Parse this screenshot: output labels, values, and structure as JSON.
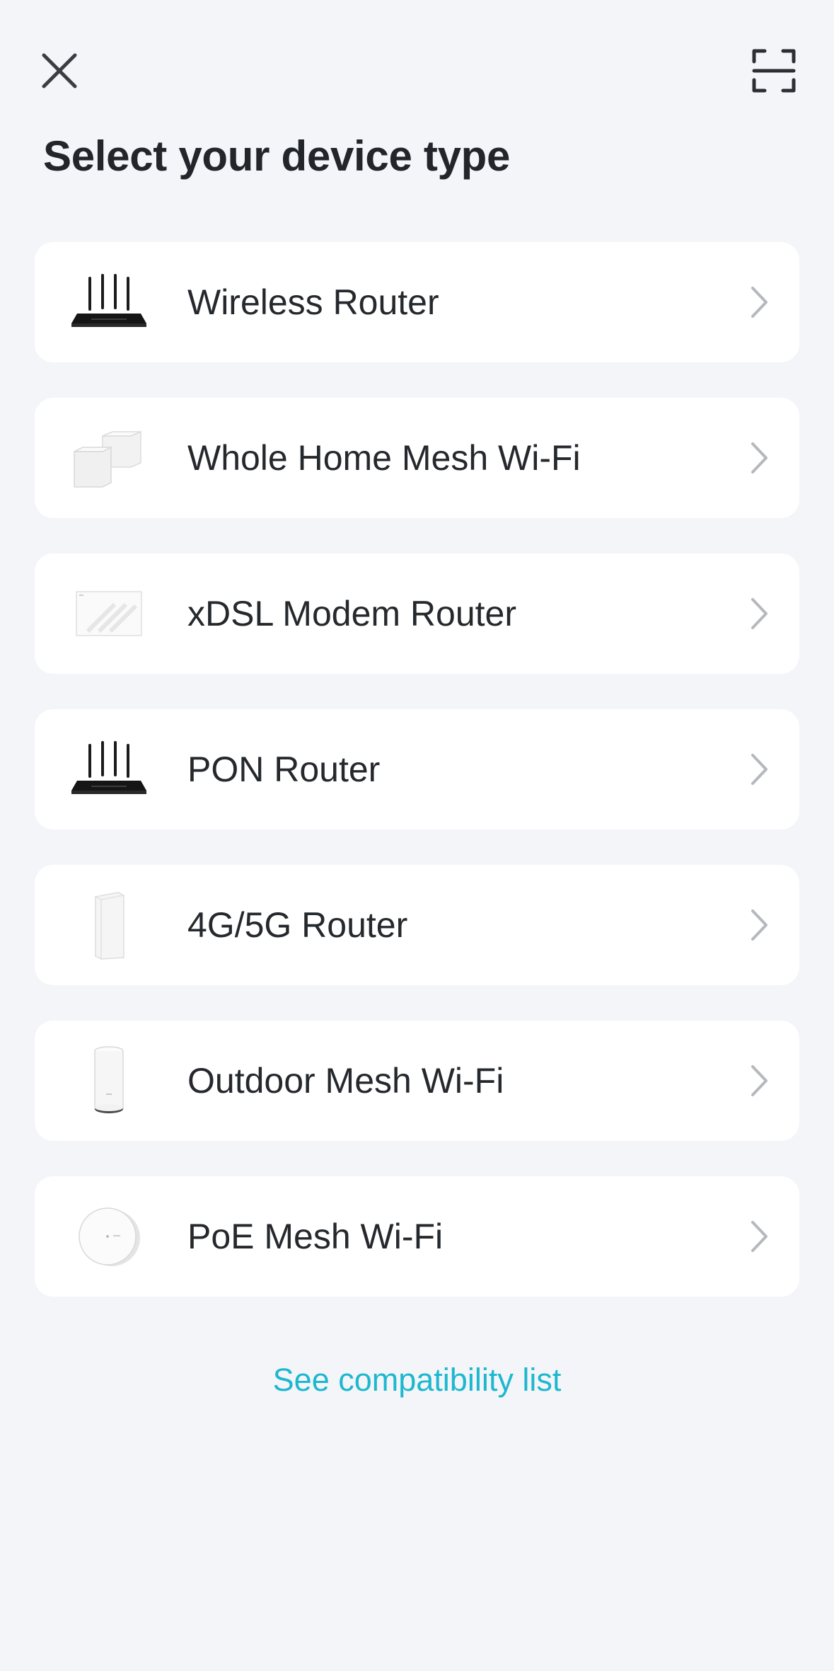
{
  "header": {
    "title": "Select your device type",
    "close_icon": "close-icon",
    "scan_icon": "scan-icon"
  },
  "devices": [
    {
      "label": "Wireless Router",
      "icon": "wireless-router-icon"
    },
    {
      "label": "Whole Home Mesh Wi-Fi",
      "icon": "mesh-wifi-icon"
    },
    {
      "label": "xDSL Modem Router",
      "icon": "modem-router-icon"
    },
    {
      "label": "PON Router",
      "icon": "pon-router-icon"
    },
    {
      "label": "4G/5G Router",
      "icon": "cellular-router-icon"
    },
    {
      "label": "Outdoor Mesh Wi-Fi",
      "icon": "outdoor-mesh-icon"
    },
    {
      "label": "PoE Mesh Wi-Fi",
      "icon": "poe-mesh-icon"
    }
  ],
  "footer": {
    "compatibility_link": "See compatibility list"
  },
  "colors": {
    "background": "#f4f5f9",
    "card": "#ffffff",
    "accent": "#1db8cf",
    "text": "#22262b",
    "chevron": "#b5b8bd"
  }
}
